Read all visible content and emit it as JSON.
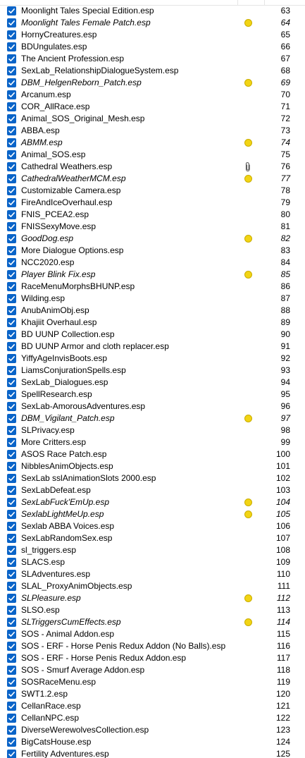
{
  "plugins": [
    {
      "name": "Moonlight Tales Special Edition.esp",
      "priority": "63",
      "flag": null
    },
    {
      "name": "Moonlight Tales Female Patch.esp",
      "priority": "64",
      "flag": "warning"
    },
    {
      "name": "HornyCreatures.esp",
      "priority": "65",
      "flag": null
    },
    {
      "name": "BDUngulates.esp",
      "priority": "66",
      "flag": null
    },
    {
      "name": "The Ancient Profession.esp",
      "priority": "67",
      "flag": null
    },
    {
      "name": "SexLab_RelationshipDialogueSystem.esp",
      "priority": "68",
      "flag": null
    },
    {
      "name": "DBM_HelgenReborn_Patch.esp",
      "priority": "69",
      "flag": "warning"
    },
    {
      "name": "Arcanum.esp",
      "priority": "70",
      "flag": null
    },
    {
      "name": "COR_AllRace.esp",
      "priority": "71",
      "flag": null
    },
    {
      "name": "Animal_SOS_Original_Mesh.esp",
      "priority": "72",
      "flag": null
    },
    {
      "name": "ABBA.esp",
      "priority": "73",
      "flag": null
    },
    {
      "name": "ABMM.esp",
      "priority": "74",
      "flag": "warning"
    },
    {
      "name": "Animal_SOS.esp",
      "priority": "75",
      "flag": null
    },
    {
      "name": "Cathedral Weathers.esp",
      "priority": "76",
      "flag": "attachment"
    },
    {
      "name": "CathedralWeatherMCM.esp",
      "priority": "77",
      "flag": "warning"
    },
    {
      "name": "Customizable Camera.esp",
      "priority": "78",
      "flag": null
    },
    {
      "name": "FireAndIceOverhaul.esp",
      "priority": "79",
      "flag": null
    },
    {
      "name": "FNIS_PCEA2.esp",
      "priority": "80",
      "flag": null
    },
    {
      "name": "FNISSexyMove.esp",
      "priority": "81",
      "flag": null
    },
    {
      "name": "GoodDog.esp",
      "priority": "82",
      "flag": "warning"
    },
    {
      "name": "More Dialogue Options.esp",
      "priority": "83",
      "flag": null
    },
    {
      "name": "NCC2020.esp",
      "priority": "84",
      "flag": null
    },
    {
      "name": "Player Blink Fix.esp",
      "priority": "85",
      "flag": "warning"
    },
    {
      "name": "RaceMenuMorphsBHUNP.esp",
      "priority": "86",
      "flag": null
    },
    {
      "name": "Wilding.esp",
      "priority": "87",
      "flag": null
    },
    {
      "name": "AnubAnimObj.esp",
      "priority": "88",
      "flag": null
    },
    {
      "name": "Khajiit Overhaul.esp",
      "priority": "89",
      "flag": null
    },
    {
      "name": "BD UUNP Collection.esp",
      "priority": "90",
      "flag": null
    },
    {
      "name": "BD UUNP Armor and cloth replacer.esp",
      "priority": "91",
      "flag": null
    },
    {
      "name": "YiffyAgeInvisBoots.esp",
      "priority": "92",
      "flag": null
    },
    {
      "name": "LiamsConjurationSpells.esp",
      "priority": "93",
      "flag": null
    },
    {
      "name": "SexLab_Dialogues.esp",
      "priority": "94",
      "flag": null
    },
    {
      "name": "SpellResearch.esp",
      "priority": "95",
      "flag": null
    },
    {
      "name": "SexLab-AmorousAdventures.esp",
      "priority": "96",
      "flag": null
    },
    {
      "name": "DBM_Vigilant_Patch.esp",
      "priority": "97",
      "flag": "warning"
    },
    {
      "name": "SLPrivacy.esp",
      "priority": "98",
      "flag": null
    },
    {
      "name": "More Critters.esp",
      "priority": "99",
      "flag": null
    },
    {
      "name": "ASOS Race Patch.esp",
      "priority": "100",
      "flag": null
    },
    {
      "name": "NibblesAnimObjects.esp",
      "priority": "101",
      "flag": null
    },
    {
      "name": "SexLab sslAnimationSlots 2000.esp",
      "priority": "102",
      "flag": null
    },
    {
      "name": "SexLabDefeat.esp",
      "priority": "103",
      "flag": null
    },
    {
      "name": "SexLabFuck'EmUp.esp",
      "priority": "104",
      "flag": "warning"
    },
    {
      "name": "SexlabLightMeUp.esp",
      "priority": "105",
      "flag": "warning"
    },
    {
      "name": "Sexlab ABBA Voices.esp",
      "priority": "106",
      "flag": null
    },
    {
      "name": "SexLabRandomSex.esp",
      "priority": "107",
      "flag": null
    },
    {
      "name": "sl_triggers.esp",
      "priority": "108",
      "flag": null
    },
    {
      "name": "SLACS.esp",
      "priority": "109",
      "flag": null
    },
    {
      "name": "SLAdventures.esp",
      "priority": "110",
      "flag": null
    },
    {
      "name": "SLAL_ProxyAnimObjects.esp",
      "priority": "111",
      "flag": null
    },
    {
      "name": "SLPleasure.esp",
      "priority": "112",
      "flag": "warning"
    },
    {
      "name": "SLSO.esp",
      "priority": "113",
      "flag": null
    },
    {
      "name": "SLTriggersCumEffects.esp",
      "priority": "114",
      "flag": "warning"
    },
    {
      "name": "SOS - Animal Addon.esp",
      "priority": "115",
      "flag": null
    },
    {
      "name": "SOS - ERF - Horse Penis Redux Addon (No Balls).esp",
      "priority": "116",
      "flag": null
    },
    {
      "name": "SOS - ERF - Horse Penis Redux Addon.esp",
      "priority": "117",
      "flag": null
    },
    {
      "name": "SOS - Smurf Average Addon.esp",
      "priority": "118",
      "flag": null
    },
    {
      "name": "SOSRaceMenu.esp",
      "priority": "119",
      "flag": null
    },
    {
      "name": "SWT1.2.esp",
      "priority": "120",
      "flag": null
    },
    {
      "name": "CellanRace.esp",
      "priority": "121",
      "flag": null
    },
    {
      "name": "CellanNPC.esp",
      "priority": "122",
      "flag": null
    },
    {
      "name": "DiverseWerewolvesCollection.esp",
      "priority": "123",
      "flag": null
    },
    {
      "name": "BigCatsHouse.esp",
      "priority": "124",
      "flag": null
    },
    {
      "name": "Fertility Adventures.esp",
      "priority": "125",
      "flag": null
    }
  ],
  "colors": {
    "checkbox": "#0a64c8",
    "warning_flag": "#f2d414"
  },
  "icons": {
    "checked": "checkmark-icon",
    "warning": "yellow-dot-flag-icon",
    "attachment": "paperclip-icon"
  }
}
